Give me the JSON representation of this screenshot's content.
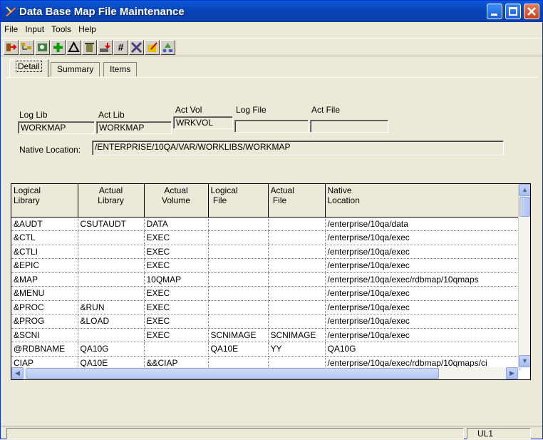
{
  "window": {
    "title": "Data Base Map File Maintenance"
  },
  "menu": [
    "File",
    "Input",
    "Tools",
    "Help"
  ],
  "toolbar": {
    "icons": [
      "exit-icon",
      "tree-icon",
      "map-icon",
      "add-icon",
      "triangle-icon",
      "delete-icon",
      "import-icon",
      "hash-icon",
      "tools-icon",
      "edit-icon",
      "shapes-icon"
    ],
    "labels": [
      "#"
    ]
  },
  "tabs": [
    {
      "label": "Detail",
      "accel": "D"
    },
    {
      "label": "Summary",
      "accel": "S"
    },
    {
      "label": "Items",
      "accel": "t"
    }
  ],
  "detail": {
    "log_lib_label": "Log Lib",
    "log_lib_value": "WORKMAP",
    "act_lib_label": "Act Lib",
    "act_lib_value": "WORKMAP",
    "act_vol_label": "Act Vol",
    "act_vol_value": "WRKVOL",
    "log_file_label": "Log File",
    "log_file_value": "",
    "act_file_label": "Act File",
    "act_file_value": "",
    "native_label": "Native Location:",
    "native_value": "/ENTERPRISE/10QA/VAR/WORKLIBS/WORKMAP"
  },
  "grid": {
    "headers": [
      [
        "Logical",
        "Library"
      ],
      [
        "Actual",
        "Library"
      ],
      [
        "Actual",
        "Volume"
      ],
      [
        "Logical",
        "File"
      ],
      [
        "Actual",
        "File"
      ],
      [
        "Native",
        "Location"
      ]
    ],
    "rows": [
      [
        "&AUDT",
        "CSUTAUDT",
        "DATA",
        "",
        "",
        "/enterprise/10qa/data"
      ],
      [
        "&CTL",
        "",
        "EXEC",
        "",
        "",
        "/enterprise/10qa/exec"
      ],
      [
        "&CTLI",
        "",
        "EXEC",
        "",
        "",
        "/enterprise/10qa/exec"
      ],
      [
        "&EPIC",
        "",
        "EXEC",
        "",
        "",
        "/enterprise/10qa/exec"
      ],
      [
        "&MAP",
        "",
        "10QMAP",
        "",
        "",
        "/enterprise/10qa/exec/rdbmap/10qmaps"
      ],
      [
        "&MENU",
        "",
        "EXEC",
        "",
        "",
        "/enterprise/10qa/exec"
      ],
      [
        "&PROC",
        "&RUN",
        "EXEC",
        "",
        "",
        "/enterprise/10qa/exec"
      ],
      [
        "&PROG",
        "&LOAD",
        "EXEC",
        "",
        "",
        "/enterprise/10qa/exec"
      ],
      [
        "&SCNI",
        "",
        "EXEC",
        "SCNIMAGE",
        "SCNIMAGE",
        "/enterprise/10qa/exec"
      ],
      [
        "@RDBNAME",
        "QA10G",
        "",
        "QA10E",
        "YY",
        "QA10G"
      ],
      [
        "CIAP",
        "QA10E",
        "&&CIAP",
        "",
        "",
        "/enterprise/10qa/exec/rdbmap/10qmaps/ci"
      ]
    ]
  },
  "status": {
    "cell": "UL1"
  }
}
